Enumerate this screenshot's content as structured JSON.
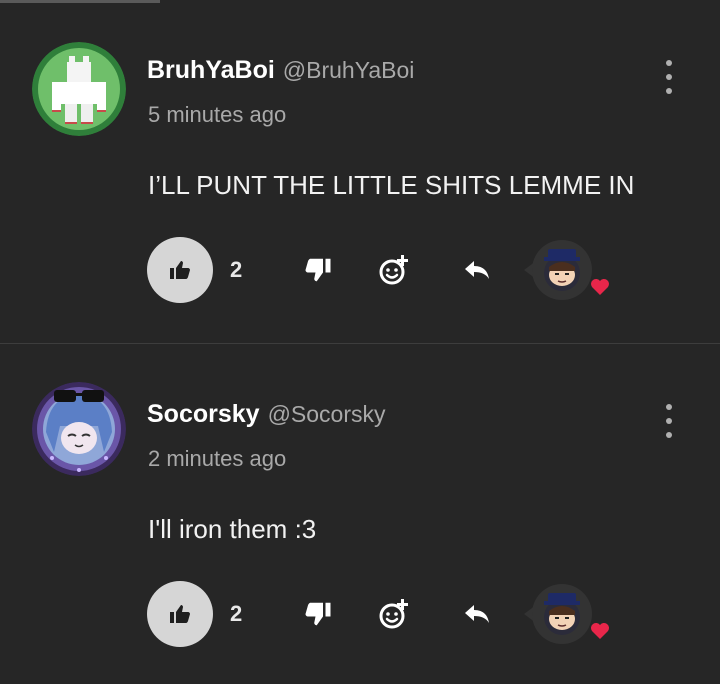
{
  "comments": [
    {
      "display_name": "BruhYaBoi",
      "handle": "@BruhYaBoi",
      "timestamp": "5 minutes ago",
      "text": "I’LL PUNT THE LITTLE SHITS LEMME IN",
      "like_count": "2"
    },
    {
      "display_name": "Socorsky",
      "handle": "@Socorsky",
      "timestamp": "2 minutes ago",
      "text": "I'll iron them :3",
      "like_count": "2"
    }
  ],
  "icons": {
    "like": "thumbs-up-icon",
    "dislike": "thumbs-down-icon",
    "react": "add-reaction-icon",
    "reply": "reply-icon",
    "more": "more-vertical-icon",
    "heart": "heart-icon"
  },
  "colors": {
    "background": "#262626",
    "like_button": "#d6d6d6",
    "heart": "#e8264a",
    "muted_text": "#a9a9a9"
  }
}
